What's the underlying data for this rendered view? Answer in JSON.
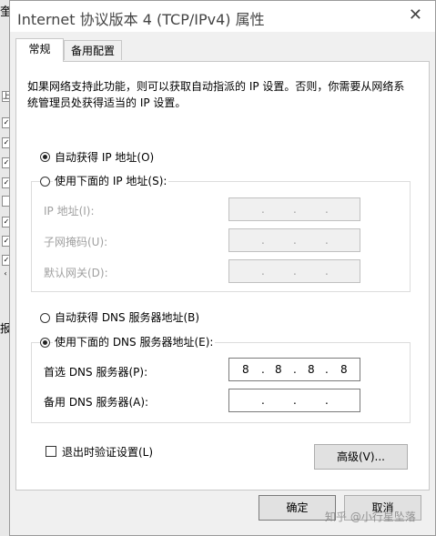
{
  "background": {
    "label_fragment": "奎",
    "marks": [
      "上",
      "✓",
      "✓",
      "✓",
      "✓",
      "",
      "✓",
      "✓",
      "✓",
      "‹",
      "",
      "报"
    ]
  },
  "window": {
    "title": "Internet 协议版本 4 (TCP/IPv4) 属性",
    "close_glyph": "✕"
  },
  "tabs": [
    {
      "label": "常规",
      "active": true
    },
    {
      "label": "备用配置",
      "active": false
    }
  ],
  "general": {
    "description": "如果网络支持此功能，则可以获取自动指派的 IP 设置。否则，你需要从网络系统管理员处获得适当的 IP 设置。",
    "ip": {
      "auto_label": "自动获得 IP 地址(O)",
      "auto_selected": true,
      "manual_label": "使用下面的 IP 地址(S):",
      "manual_selected": false,
      "fields": [
        {
          "label": "IP 地址(I):",
          "octets": [
            "",
            "",
            "",
            ""
          ]
        },
        {
          "label": "子网掩码(U):",
          "octets": [
            "",
            "",
            "",
            ""
          ]
        },
        {
          "label": "默认网关(D):",
          "octets": [
            "",
            "",
            "",
            ""
          ]
        }
      ]
    },
    "dns": {
      "auto_label": "自动获得 DNS 服务器地址(B)",
      "auto_selected": false,
      "manual_label": "使用下面的 DNS 服务器地址(E):",
      "manual_selected": true,
      "fields": [
        {
          "label": "首选 DNS 服务器(P):",
          "octets": [
            "8",
            "8",
            "8",
            "8"
          ]
        },
        {
          "label": "备用 DNS 服务器(A):",
          "octets": [
            "",
            "",
            "",
            ""
          ]
        }
      ]
    },
    "validate_label": "退出时验证设置(L)",
    "validate_checked": false,
    "advanced_label": "高级(V)..."
  },
  "buttons": {
    "ok": "确定",
    "cancel": "取消"
  },
  "watermark": "知乎 @小行星坠落"
}
